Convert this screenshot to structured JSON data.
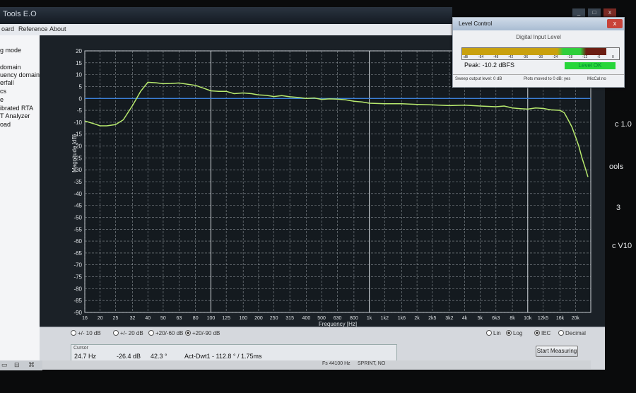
{
  "window": {
    "title": "Tools E.O"
  },
  "menu": {
    "items": [
      "oard",
      "Reference",
      "About"
    ]
  },
  "window_controls": [
    "_",
    "□",
    "x"
  ],
  "left_panel": {
    "items": [
      "g mode",
      "",
      "domain",
      "uency domain",
      "erfall",
      "cs",
      "e",
      "ibrated RTA",
      "T Analyzer",
      "oad"
    ]
  },
  "right_edge_labels": [
    "c 1.0",
    "ools",
    "3",
    "c V10"
  ],
  "chart_data": {
    "type": "line",
    "xlabel": "Frequency [Hz]",
    "ylabel": "Magnitude [dB]",
    "x_scale": "log",
    "xlim": [
      16,
      25000
    ],
    "ylim": [
      -90,
      20
    ],
    "y_ticks": [
      20,
      15,
      10,
      5,
      0,
      -5,
      -10,
      -15,
      -20,
      -25,
      -30,
      -35,
      -40,
      -45,
      -50,
      -55,
      -60,
      -65,
      -70,
      -75,
      -80,
      -85,
      -90
    ],
    "x_ticks": [
      {
        "v": 16,
        "label": "16"
      },
      {
        "v": 20,
        "label": "20"
      },
      {
        "v": 25,
        "label": "25"
      },
      {
        "v": 32,
        "label": "32"
      },
      {
        "v": 40,
        "label": "40"
      },
      {
        "v": 50,
        "label": "50"
      },
      {
        "v": 63,
        "label": "63"
      },
      {
        "v": 80,
        "label": "80"
      },
      {
        "v": 100,
        "label": "100"
      },
      {
        "v": 125,
        "label": "125"
      },
      {
        "v": 160,
        "label": "160"
      },
      {
        "v": 200,
        "label": "200"
      },
      {
        "v": 250,
        "label": "250"
      },
      {
        "v": 315,
        "label": "315"
      },
      {
        "v": 400,
        "label": "400"
      },
      {
        "v": 500,
        "label": "500"
      },
      {
        "v": 630,
        "label": "630"
      },
      {
        "v": 800,
        "label": "800"
      },
      {
        "v": 1000,
        "label": "1k"
      },
      {
        "v": 1250,
        "label": "1k2"
      },
      {
        "v": 1600,
        "label": "1k6"
      },
      {
        "v": 2000,
        "label": "2k"
      },
      {
        "v": 2500,
        "label": "2k5"
      },
      {
        "v": 3200,
        "label": "3k2"
      },
      {
        "v": 4000,
        "label": "4k"
      },
      {
        "v": 5000,
        "label": "5k"
      },
      {
        "v": 6300,
        "label": "6k3"
      },
      {
        "v": 8000,
        "label": "8k"
      },
      {
        "v": 10000,
        "label": "10k"
      },
      {
        "v": 12500,
        "label": "12k5"
      },
      {
        "v": 16000,
        "label": "16k"
      },
      {
        "v": 20000,
        "label": "20k"
      }
    ],
    "reference_line_y": 0,
    "grid": true,
    "series": [
      {
        "color": "#b8ea6e",
        "x": [
          16,
          18,
          20,
          22,
          25,
          28,
          32,
          36,
          40,
          45,
          50,
          56,
          63,
          71,
          80,
          90,
          100,
          112,
          125,
          140,
          160,
          180,
          200,
          224,
          250,
          280,
          315,
          355,
          400,
          450,
          500,
          560,
          630,
          710,
          800,
          900,
          1000,
          1250,
          1600,
          2000,
          2500,
          3200,
          4000,
          5000,
          6300,
          7100,
          8000,
          9000,
          10000,
          11200,
          12500,
          14000,
          16000,
          17000,
          18000,
          19000,
          20000,
          21000,
          22000,
          23000,
          24000
        ],
        "y": [
          -9.5,
          -10.5,
          -11.5,
          -11.5,
          -11,
          -9,
          -3,
          3,
          6.8,
          6.6,
          6.2,
          6.3,
          6.5,
          6,
          5.5,
          4.3,
          3.2,
          3,
          3,
          2,
          2.3,
          2,
          1.5,
          1.3,
          0.8,
          1.2,
          0.7,
          0.4,
          0,
          0.2,
          -0.4,
          -0.2,
          -0.3,
          -0.6,
          -1.2,
          -1.5,
          -2,
          -2.2,
          -2.2,
          -2.5,
          -2.7,
          -3,
          -2.8,
          -3.2,
          -3.5,
          -3.2,
          -4,
          -4.3,
          -4.5,
          -4,
          -4.2,
          -4.8,
          -5,
          -6,
          -9,
          -12,
          -16,
          -20,
          -25,
          -29,
          -33
        ]
      }
    ]
  },
  "bottom": {
    "radios": [
      {
        "label": "+/- 10 dB",
        "on": false
      },
      {
        "label": "+/- 20 dB",
        "on": false
      },
      {
        "label": "+20/-60 dB",
        "on": false
      },
      {
        "label": "+20/-90 dB",
        "on": true
      }
    ],
    "scale_radios": [
      {
        "label": "Lin",
        "on": false
      },
      {
        "label": "Log",
        "on": true
      }
    ],
    "band_radios": [
      {
        "label": "IEC",
        "on": true
      },
      {
        "label": "Decimal",
        "on": false
      }
    ],
    "cursor": {
      "label": "Cursor",
      "freq": "24.7 Hz",
      "mag": "-26.4 dB",
      "phase": "42.3 °",
      "delay": "Act-Dwt1 - 112.8 ° / 1.75ms"
    },
    "start_button": "Start Measuring",
    "status": [
      "Fs 44100 Hz",
      "SPRINT, NO"
    ]
  },
  "taskbar": {
    "icons": [
      "▭",
      "⊟",
      "⌘"
    ]
  },
  "level_control": {
    "title": "Level Control",
    "close": "x",
    "heading": "Digital Input Level",
    "scale": [
      "dB",
      "-54",
      "-48",
      "-42",
      "-36",
      "-30",
      "-24",
      "-18",
      "-12",
      "-6",
      "0"
    ],
    "fill_fraction": 0.92,
    "peak_label": "Peak:",
    "peak_value": "-10.2 dBFS",
    "status": "Level OK",
    "footer": [
      "Sweep output level: 0 dB",
      "Plots moved to 0 dB: yes",
      "MicCal:no"
    ]
  }
}
